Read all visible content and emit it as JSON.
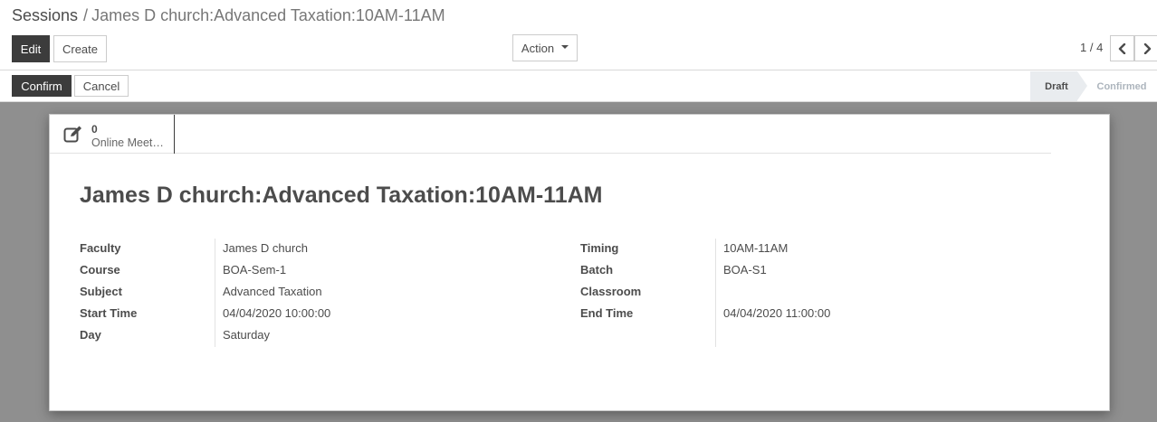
{
  "breadcrumb": {
    "parent": "Sessions",
    "separator": "/",
    "current": "James D church:Advanced Taxation:10AM-11AM"
  },
  "toolbar": {
    "edit_label": "Edit",
    "create_label": "Create",
    "action_label": "Action"
  },
  "pager": {
    "value": "1 / 4",
    "prev_icon": "chevron-left-icon",
    "next_icon": "chevron-right-icon"
  },
  "statusbar": {
    "confirm_label": "Confirm",
    "cancel_label": "Cancel",
    "stages": [
      "Draft",
      "Confirmed"
    ],
    "current_stage": "Draft"
  },
  "smart_button": {
    "icon": "edit-icon",
    "count": "0",
    "label": "Online Meet…"
  },
  "record": {
    "title": "James D church:Advanced Taxation:10AM-11AM"
  },
  "fields_left": [
    {
      "label": "Faculty",
      "value": "James D church"
    },
    {
      "label": "Course",
      "value": "BOA-Sem-1"
    },
    {
      "label": "Subject",
      "value": "Advanced Taxation"
    },
    {
      "label": "Start Time",
      "value": "04/04/2020 10:00:00"
    },
    {
      "label": "Day",
      "value": "Saturday"
    }
  ],
  "fields_right": [
    {
      "label": "Timing",
      "value": "10AM-11AM"
    },
    {
      "label": "Batch",
      "value": "BOA-S1"
    },
    {
      "label": "Classroom",
      "value": ""
    },
    {
      "label": "End Time",
      "value": "04/04/2020 11:00:00"
    }
  ],
  "colors": {
    "primary_button": "#3c3c3c",
    "page_background": "#8f8f8f",
    "active_stage": "#e9ecef"
  }
}
